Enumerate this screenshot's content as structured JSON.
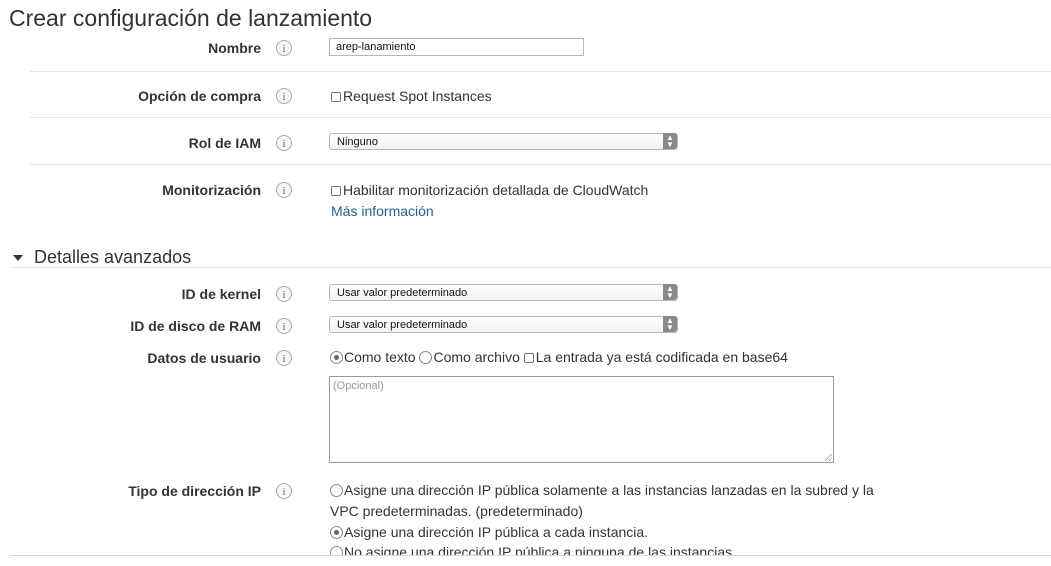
{
  "page": {
    "title": "Crear configuración de lanzamiento"
  },
  "info_glyph": "i",
  "form": {
    "name": {
      "label": "Nombre",
      "value": "arep-lanamiento"
    },
    "purchase": {
      "label": "Opción de compra",
      "checkbox_label": "Request Spot Instances",
      "checked": false
    },
    "iam": {
      "label": "Rol de IAM",
      "selected": "Ninguno"
    },
    "monitoring": {
      "label": "Monitorización",
      "checkbox_label": "Habilitar monitorización detallada de CloudWatch",
      "checked": false,
      "link": "Más información"
    }
  },
  "advanced": {
    "title": "Detalles avanzados",
    "kernel": {
      "label": "ID de kernel",
      "selected": "Usar valor predeterminado"
    },
    "ramdisk": {
      "label": "ID de disco de RAM",
      "selected": "Usar valor predeterminado"
    },
    "userdata": {
      "label": "Datos de usuario",
      "opt_text": "Como texto",
      "opt_file": "Como archivo",
      "base64_label": "La entrada ya está codificada en base64",
      "selected": "Como texto",
      "placeholder": "(Opcional)"
    },
    "ip": {
      "label": "Tipo de dirección IP",
      "options": [
        {
          "line1": "Asigne una dirección IP pública solamente a las instancias lanzadas en la subred y la",
          "line2": "VPC predeterminadas. (predeterminado)",
          "selected": false
        },
        {
          "line1": "Asigne una dirección IP pública a cada instancia.",
          "selected": true
        },
        {
          "line1": "No asigne una dirección IP pública a ninguna de las instancias.",
          "selected": false
        }
      ]
    }
  }
}
